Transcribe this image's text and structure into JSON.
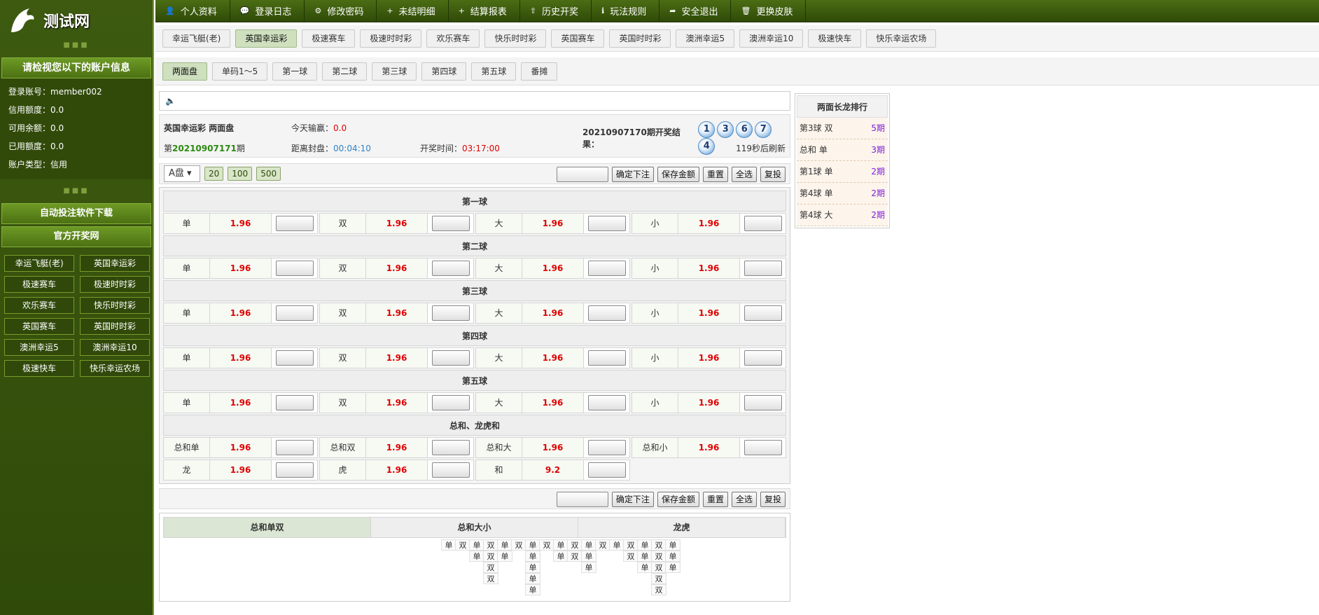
{
  "brand": {
    "name": "测试网"
  },
  "sidebar": {
    "account_header": "请检视您以下的账户信息",
    "info": [
      {
        "label": "登录账号：",
        "value": "member002"
      },
      {
        "label": "信用额度：",
        "value": "0.0"
      },
      {
        "label": "可用余额：",
        "value": "0.0"
      },
      {
        "label": "已用额度：",
        "value": "0.0"
      },
      {
        "label": "账户类型：",
        "value": "信用"
      }
    ],
    "download_label": "自动投注软件下载",
    "official_label": "官方开奖网",
    "games": [
      "幸运飞艇(老)",
      "英国幸运彩",
      "极速赛车",
      "极速时时彩",
      "欢乐赛车",
      "快乐时时彩",
      "英国赛车",
      "英国时时彩",
      "澳洲幸运5",
      "澳洲幸运10",
      "极速快车",
      "快乐幸运农场"
    ]
  },
  "topnav": [
    {
      "icon": "user-icon",
      "glyph": "👤",
      "label": "个人资料"
    },
    {
      "icon": "chat-icon",
      "glyph": "💬",
      "label": "登录日志"
    },
    {
      "icon": "gear-icon",
      "glyph": "⚙",
      "label": "修改密码"
    },
    {
      "icon": "plus-icon",
      "glyph": "+",
      "label": "未结明细"
    },
    {
      "icon": "plus-icon",
      "glyph": "+",
      "label": "结算报表"
    },
    {
      "icon": "upload-icon",
      "glyph": "⇧",
      "label": "历史开奖"
    },
    {
      "icon": "info-icon",
      "glyph": "ℹ",
      "label": "玩法规则"
    },
    {
      "icon": "share-icon",
      "glyph": "➦",
      "label": "安全退出"
    },
    {
      "icon": "trash-icon",
      "glyph": "🗑",
      "label": "更换皮肤"
    }
  ],
  "game_tabs": [
    "幸运飞艇(老)",
    "英国幸运彩",
    "极速赛车",
    "极速时时彩",
    "欢乐赛车",
    "快乐时时彩",
    "英国赛车",
    "英国时时彩",
    "澳洲幸运5",
    "澳洲幸运10",
    "极速快车",
    "快乐幸运农场"
  ],
  "active_game": "英国幸运彩",
  "sub_tabs": [
    "两面盘",
    "单码1～5",
    "第一球",
    "第二球",
    "第三球",
    "第四球",
    "第五球",
    "番摊"
  ],
  "status": {
    "game_title": "英国幸运彩 两面盘",
    "today_label": "今天输赢：",
    "today_value": "0.0",
    "last_result_label": "20210907170期开奖结果：",
    "balls": [
      "1",
      "3",
      "6",
      "7",
      "4"
    ],
    "period_prefix": "第",
    "period_number": "20210907171",
    "period_suffix": "期",
    "close_label": "距离封盘：",
    "close_value": "00:04:10",
    "draw_label": "开奖时间：",
    "draw_value": "03:17:00",
    "refresh": "119秒后刷新"
  },
  "controls": {
    "plate": "A盘",
    "amounts": [
      "20",
      "100",
      "500"
    ],
    "confirm": "确定下注",
    "save": "保存金额",
    "reset": "重置",
    "select_all": "全选",
    "repeat": "复投"
  },
  "sections": [
    {
      "title": "第一球",
      "rows": [
        [
          {
            "l": "单",
            "o": "1.96"
          },
          {
            "l": "双",
            "o": "1.96"
          },
          {
            "l": "大",
            "o": "1.96"
          },
          {
            "l": "小",
            "o": "1.96"
          }
        ]
      ]
    },
    {
      "title": "第二球",
      "rows": [
        [
          {
            "l": "单",
            "o": "1.96"
          },
          {
            "l": "双",
            "o": "1.96"
          },
          {
            "l": "大",
            "o": "1.96"
          },
          {
            "l": "小",
            "o": "1.96"
          }
        ]
      ]
    },
    {
      "title": "第三球",
      "rows": [
        [
          {
            "l": "单",
            "o": "1.96"
          },
          {
            "l": "双",
            "o": "1.96"
          },
          {
            "l": "大",
            "o": "1.96"
          },
          {
            "l": "小",
            "o": "1.96"
          }
        ]
      ]
    },
    {
      "title": "第四球",
      "rows": [
        [
          {
            "l": "单",
            "o": "1.96"
          },
          {
            "l": "双",
            "o": "1.96"
          },
          {
            "l": "大",
            "o": "1.96"
          },
          {
            "l": "小",
            "o": "1.96"
          }
        ]
      ]
    },
    {
      "title": "第五球",
      "rows": [
        [
          {
            "l": "单",
            "o": "1.96"
          },
          {
            "l": "双",
            "o": "1.96"
          },
          {
            "l": "大",
            "o": "1.96"
          },
          {
            "l": "小",
            "o": "1.96"
          }
        ]
      ]
    },
    {
      "title": "总和、龙虎和",
      "rows": [
        [
          {
            "l": "总和单",
            "o": "1.96"
          },
          {
            "l": "总和双",
            "o": "1.96"
          },
          {
            "l": "总和大",
            "o": "1.96"
          },
          {
            "l": "总和小",
            "o": "1.96"
          }
        ],
        [
          {
            "l": "龙",
            "o": "1.96"
          },
          {
            "l": "虎",
            "o": "1.96"
          },
          {
            "l": "和",
            "o": "9.2"
          }
        ]
      ]
    }
  ],
  "trend": {
    "tabs": [
      "总和单双",
      "总和大小",
      "龙虎"
    ],
    "columns": [
      [
        "单"
      ],
      [
        "双"
      ],
      [
        "单",
        "单"
      ],
      [
        "双",
        "双",
        "双",
        "双"
      ],
      [
        "单",
        "单"
      ],
      [
        "双"
      ],
      [
        "单",
        "单",
        "单",
        "单",
        "单"
      ],
      [
        "双"
      ],
      [
        "单",
        "单"
      ],
      [
        "双",
        "双"
      ],
      [
        "单",
        "单",
        "单"
      ],
      [
        "双"
      ],
      [
        "单"
      ],
      [
        "双",
        "双"
      ],
      [
        "单",
        "单",
        "单"
      ],
      [
        "双",
        "双",
        "双",
        "双",
        "双"
      ],
      [
        "单",
        "单",
        "单"
      ]
    ]
  },
  "rank": {
    "title": "两面长龙排行",
    "items": [
      {
        "name": "第3球 双",
        "value": "5期"
      },
      {
        "name": "总和 单",
        "value": "3期"
      },
      {
        "name": "第1球 单",
        "value": "2期"
      },
      {
        "name": "第4球 单",
        "value": "2期"
      },
      {
        "name": "第4球 大",
        "value": "2期"
      }
    ]
  }
}
